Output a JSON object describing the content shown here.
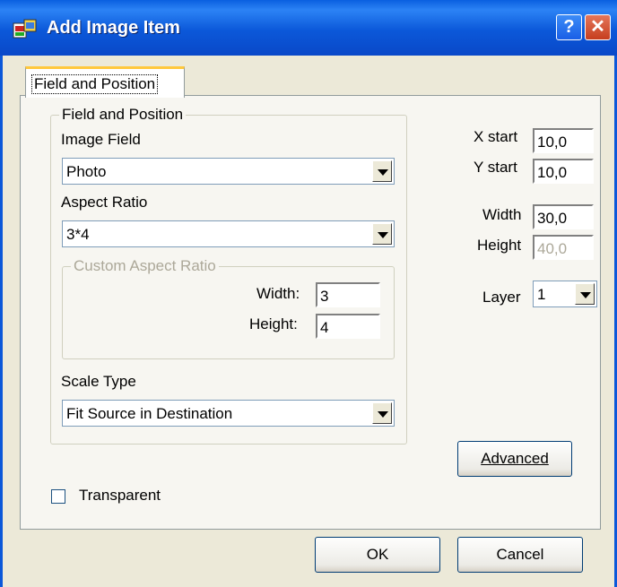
{
  "window": {
    "title": "Add Image Item",
    "help_label": "?",
    "close_label": "✕",
    "icon": "image-item-icon"
  },
  "tabs": [
    {
      "label": "Field and Position",
      "selected": true
    }
  ],
  "field_group": {
    "title": "Field and Position",
    "image_field_label": "Image Field",
    "image_field_value": "Photo",
    "aspect_ratio_label": "Aspect Ratio",
    "aspect_ratio_value": "3*4",
    "custom_group_title": "Custom Aspect Ratio",
    "custom_width_label": "Width:",
    "custom_width_value": "3",
    "custom_height_label": "Height:",
    "custom_height_value": "4",
    "scale_type_label": "Scale Type",
    "scale_type_value": "Fit Source in Destination"
  },
  "position": {
    "x_start_label": "X start",
    "x_start_value": "10,0",
    "y_start_label": "Y start",
    "y_start_value": "10,0",
    "width_label": "Width",
    "width_value": "30,0",
    "height_label": "Height",
    "height_value": "40,0",
    "layer_label": "Layer",
    "layer_value": "1"
  },
  "advanced_label": "Advanced",
  "transparent_label": "Transparent",
  "transparent_checked": false,
  "ok_label": "OK",
  "cancel_label": "Cancel"
}
